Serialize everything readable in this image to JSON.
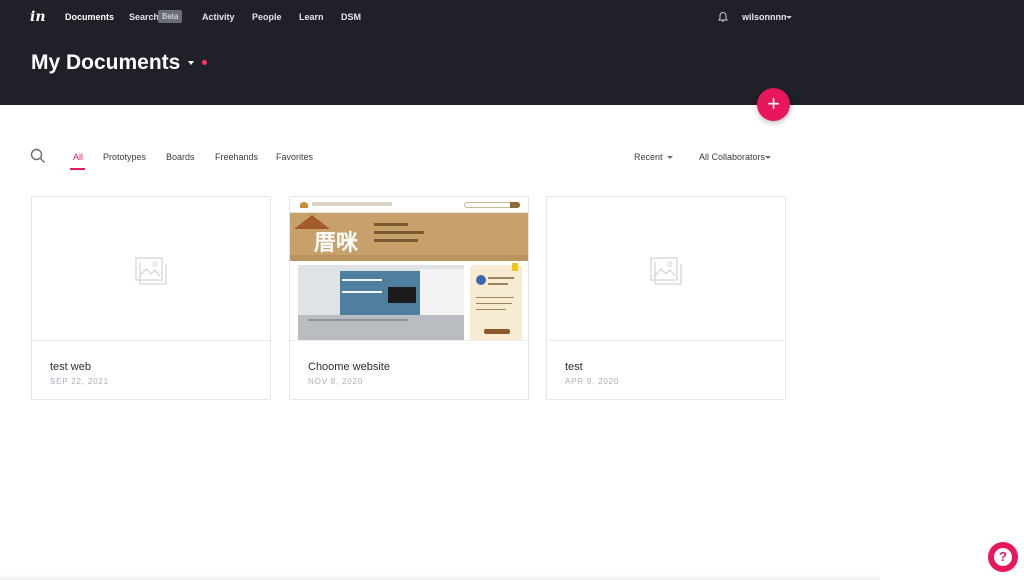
{
  "nav": {
    "logo": "in",
    "items": [
      "Documents",
      "Search",
      "Activity",
      "People",
      "Learn",
      "DSM"
    ],
    "beta_badge": "Beta",
    "username": "wilsonnnn"
  },
  "header": {
    "title": "My Documents",
    "add_button": "+"
  },
  "filters": {
    "tabs": [
      "All",
      "Prototypes",
      "Boards",
      "Freehands",
      "Favorites"
    ],
    "active_tab": "All",
    "sort": "Recent",
    "collaborators": "All Collaborators"
  },
  "documents": [
    {
      "name": "test web",
      "date": "SEP 22, 2021",
      "thumbnail": "placeholder-image-icon"
    },
    {
      "name": "Choome website",
      "date": "NOV 8, 2020",
      "thumbnail": "website-preview"
    },
    {
      "name": "test",
      "date": "APR 9, 2020",
      "thumbnail": "placeholder-image-icon"
    }
  ],
  "preview": {
    "brand": "厝咪"
  },
  "help_button": "?",
  "colors": {
    "topbar": "#1f2028",
    "accent": "#e8175d",
    "text": "#2b2c33",
    "muted": "#a9abb8"
  }
}
